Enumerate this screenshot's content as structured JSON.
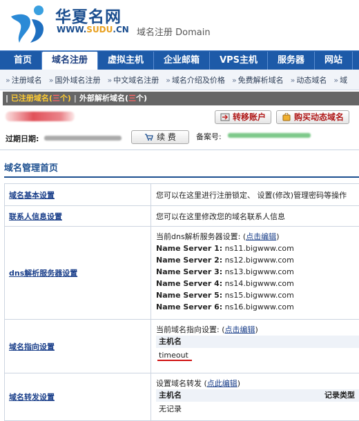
{
  "header": {
    "logo_cn": "华夏名网",
    "logo_url_pre": "WWW.",
    "logo_url_brand": "SUDU",
    "logo_url_post": ".CN",
    "site_sub": "域名注册  Domain"
  },
  "nav": {
    "items": [
      "首页",
      "域名注册",
      "虚拟主机",
      "企业邮箱",
      "VPS主机",
      "服务器",
      "网站"
    ],
    "active_index": 1
  },
  "subnav": {
    "items": [
      "注册域名",
      "国外域名注册",
      "中文域名注册",
      "域名介绍及价格",
      "免费解析域名",
      "动态域名",
      "域"
    ]
  },
  "tabbar": {
    "lead": "| ",
    "registered_label": "已注册域名(",
    "registered_count": "三",
    "registered_suffix": "个)",
    "separator": "|",
    "external_label": "外部解析域名(",
    "external_count": "三",
    "external_suffix": "个)"
  },
  "info": {
    "transfer_button": "转移账户",
    "buy_button": "购买动态域名",
    "expiry_label": "过期日期:",
    "renew_button": "续 费",
    "beian_label": "备案号:"
  },
  "section": {
    "title": "域名管理首页"
  },
  "rows": {
    "basic": {
      "label": "域名基本设置",
      "desc": "您可以在这里进行注册锁定、 设置(修改)管理密码等操作"
    },
    "contact": {
      "label": "联系人信息设置",
      "desc": "您可以在这里修改您的域名联系人信息"
    },
    "dns": {
      "label": "dns解析服务器设置",
      "intro": "当前dns解析服务器设置: (",
      "edit": "点击编辑",
      "close": ")",
      "servers": [
        {
          "name": "Name Server 1:",
          "value": "ns11.bigwww.com"
        },
        {
          "name": "Name Server 2:",
          "value": "ns12.bigwww.com"
        },
        {
          "name": "Name Server 3:",
          "value": "ns13.bigwww.com"
        },
        {
          "name": "Name Server 4:",
          "value": "ns14.bigwww.com"
        },
        {
          "name": "Name Server 5:",
          "value": "ns15.bigwww.com"
        },
        {
          "name": "Name Server 6:",
          "value": "ns16.bigwww.com"
        }
      ]
    },
    "pointing": {
      "label": "域名指向设置",
      "intro": "当前域名指向设置: (",
      "edit": "点击编辑",
      "close": ")",
      "col_host": "主机名",
      "value": "timeout"
    },
    "forward": {
      "label": "域名转发设置",
      "intro": "设置域名转发 (",
      "edit": "点此编辑",
      "close": ")",
      "col_host": "主机名",
      "col_type": "记录类型",
      "empty": "无记录"
    }
  },
  "colors": {
    "nav_bg": "#1d5aa8",
    "brand_blue": "#1b4e8f",
    "tabbar_bg": "#666666",
    "highlight_yellow": "#ffcc33",
    "button_text_red": "#b01818"
  }
}
